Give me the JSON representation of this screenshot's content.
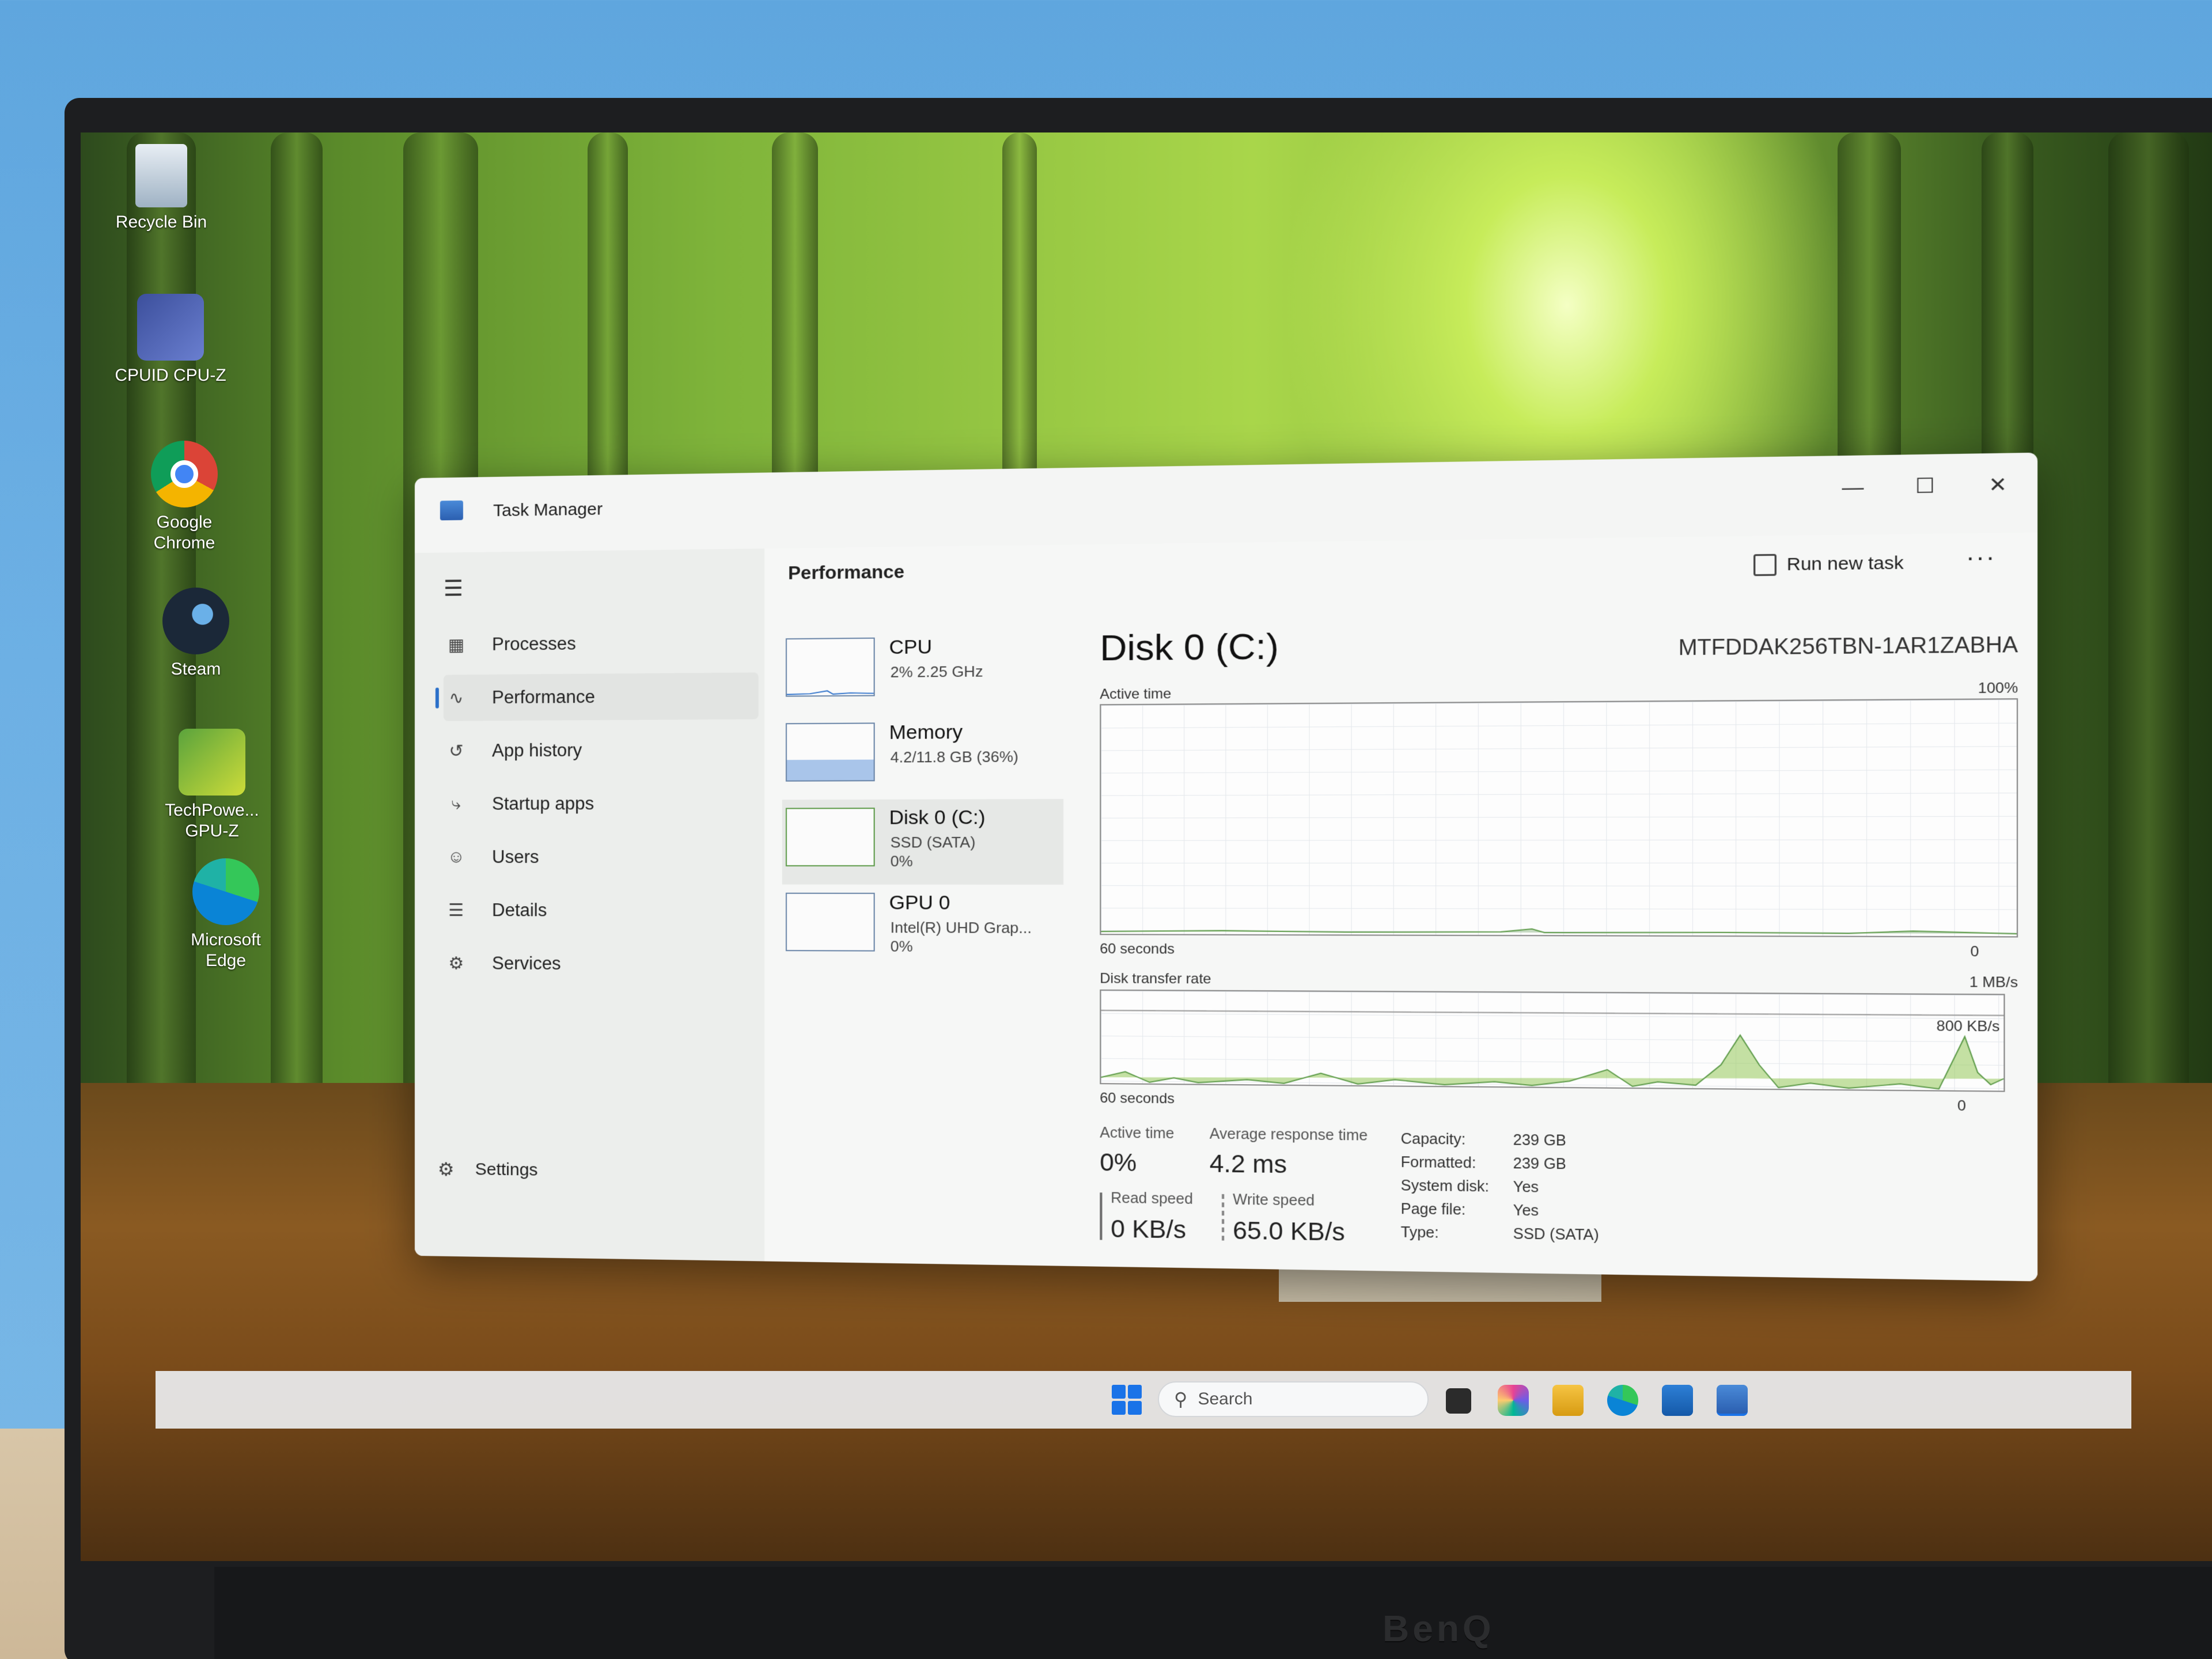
{
  "desktop": {
    "icons": [
      {
        "label": "Recycle Bin",
        "icon": "recycle-bin-icon"
      },
      {
        "label": "CPUID CPU-Z",
        "icon": "cpu-z-icon"
      },
      {
        "label": "Google Chrome",
        "icon": "chrome-icon"
      },
      {
        "label": "Steam",
        "icon": "steam-icon"
      },
      {
        "label": "TechPowe... GPU-Z",
        "icon": "gpu-z-icon"
      },
      {
        "label": "Microsoft Edge",
        "icon": "edge-icon"
      }
    ]
  },
  "monitor": {
    "brand": "BenQ"
  },
  "taskbar": {
    "search_placeholder": "Search",
    "apps": [
      "start-icon",
      "task-view-icon",
      "copilot-icon",
      "file-explorer-icon",
      "edge-icon",
      "store-icon",
      "task-manager-icon"
    ]
  },
  "window": {
    "title": "Task Manager",
    "controls": {
      "minimize": "—",
      "maximize": "☐",
      "close": "✕"
    }
  },
  "sidebar": {
    "menu_icon": "hamburger-icon",
    "items": [
      {
        "label": "Processes",
        "icon": "processes-icon"
      },
      {
        "label": "Performance",
        "icon": "performance-icon",
        "active": true
      },
      {
        "label": "App history",
        "icon": "history-icon"
      },
      {
        "label": "Startup apps",
        "icon": "startup-icon"
      },
      {
        "label": "Users",
        "icon": "users-icon"
      },
      {
        "label": "Details",
        "icon": "details-icon"
      },
      {
        "label": "Services",
        "icon": "services-icon"
      }
    ],
    "settings": {
      "label": "Settings",
      "icon": "gear-icon"
    }
  },
  "header": {
    "title": "Performance",
    "run_new_task": "Run new task",
    "more": "···"
  },
  "devices": [
    {
      "name": "CPU",
      "sub1": "2% 2.25 GHz",
      "sub2": "",
      "fill": 0.02
    },
    {
      "name": "Memory",
      "sub1": "4.2/11.8 GB (36%)",
      "sub2": "",
      "fill": 0.36
    },
    {
      "name": "Disk 0 (C:)",
      "sub1": "SSD (SATA)",
      "sub2": "0%",
      "fill": 0,
      "selected": true
    },
    {
      "name": "GPU 0",
      "sub1": "Intel(R) UHD Grap...",
      "sub2": "0%",
      "fill": 0
    }
  ],
  "detail": {
    "title": "Disk 0 (C:)",
    "model": "MTFDDAK256TBN-1AR1ZABHA",
    "graph1": {
      "label": "Active time",
      "max": "100%",
      "time": "60 seconds",
      "min": "0"
    },
    "graph2": {
      "label": "Disk transfer rate",
      "max": "1 MB/s",
      "mid": "800 KB/s",
      "time": "60 seconds",
      "min": "0"
    },
    "stats": {
      "active_time_label": "Active time",
      "active_time_value": "0%",
      "avg_response_label": "Average response time",
      "avg_response_value": "4.2 ms",
      "read_speed_label": "Read speed",
      "read_speed_value": "0 KB/s",
      "write_speed_label": "Write speed",
      "write_speed_value": "65.0 KB/s"
    },
    "properties": [
      {
        "key": "Capacity:",
        "value": "239 GB"
      },
      {
        "key": "Formatted:",
        "value": "239 GB"
      },
      {
        "key": "System disk:",
        "value": "Yes"
      },
      {
        "key": "Page file:",
        "value": "Yes"
      },
      {
        "key": "Type:",
        "value": "SSD (SATA)"
      }
    ]
  }
}
